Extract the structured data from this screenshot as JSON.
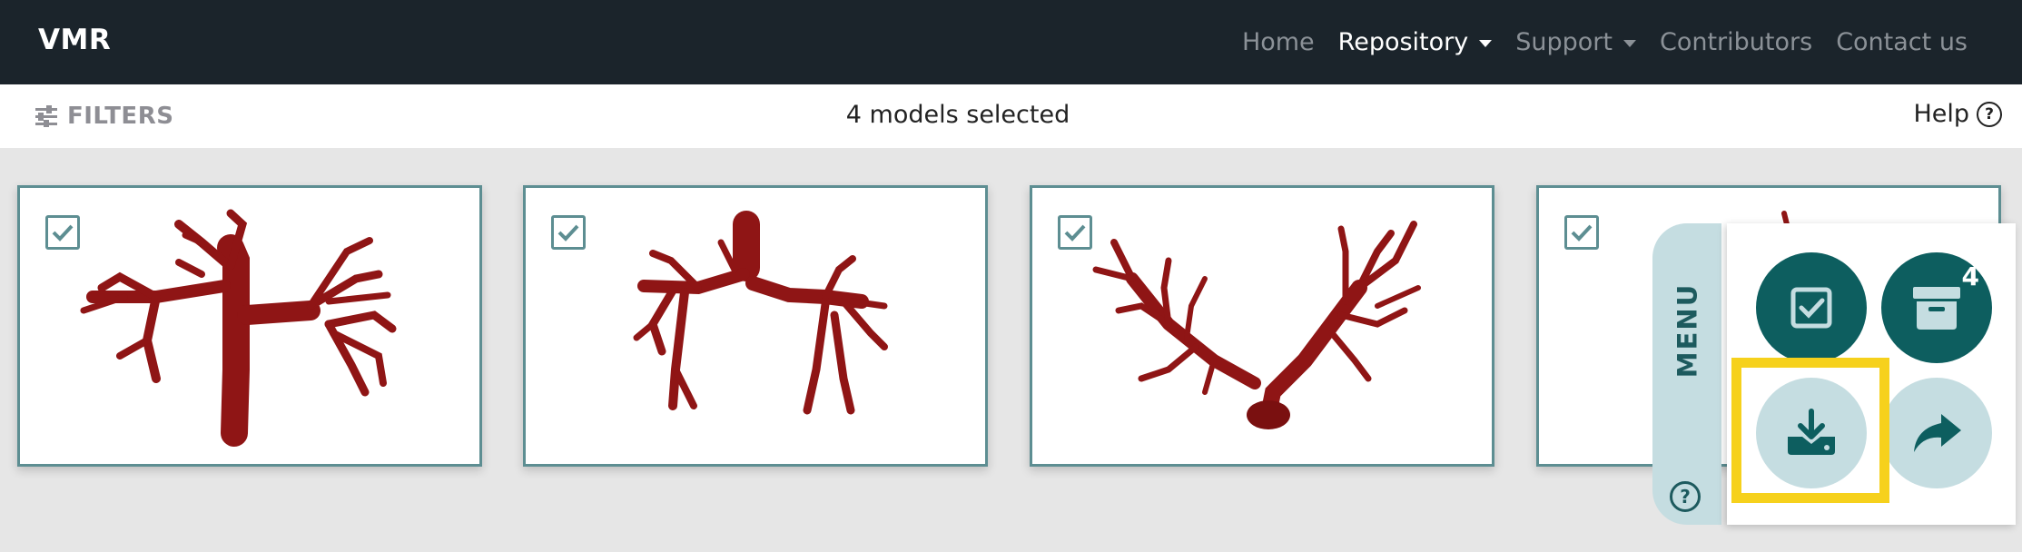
{
  "nav": {
    "brand": "VMR",
    "links": [
      {
        "label": "Home",
        "active": false,
        "dropdown": false
      },
      {
        "label": "Repository",
        "active": true,
        "dropdown": true
      },
      {
        "label": "Support",
        "active": false,
        "dropdown": true
      },
      {
        "label": "Contributors",
        "active": false,
        "dropdown": false
      },
      {
        "label": "Contact us",
        "active": false,
        "dropdown": false
      }
    ]
  },
  "filterbar": {
    "filters_label": "FILTERS",
    "filters_icon": "sliders-icon",
    "selection_text": "4 models selected",
    "help_label": "Help",
    "help_icon": "question-circle-icon"
  },
  "cards": [
    {
      "checked": true,
      "thumbnail": "vessel-model-1"
    },
    {
      "checked": true,
      "thumbnail": "vessel-model-2"
    },
    {
      "checked": true,
      "thumbnail": "vessel-model-3"
    },
    {
      "checked": true,
      "thumbnail": "vessel-model-4"
    }
  ],
  "menu": {
    "tab_label": "MENU",
    "help_icon": "question-circle-icon",
    "buttons": [
      {
        "icon": "select-all-icon"
      },
      {
        "icon": "archive-box-icon",
        "badge": "4"
      },
      {
        "icon": "download-icon",
        "highlighted": true
      },
      {
        "icon": "share-icon"
      }
    ]
  },
  "colors": {
    "navbar": "#1b242b",
    "teal_dark": "#0d5e5f",
    "teal_light": "#c5dde1",
    "card_border": "#5d8e92",
    "vessel_red": "#8f1515",
    "highlight": "#f6d11c"
  }
}
